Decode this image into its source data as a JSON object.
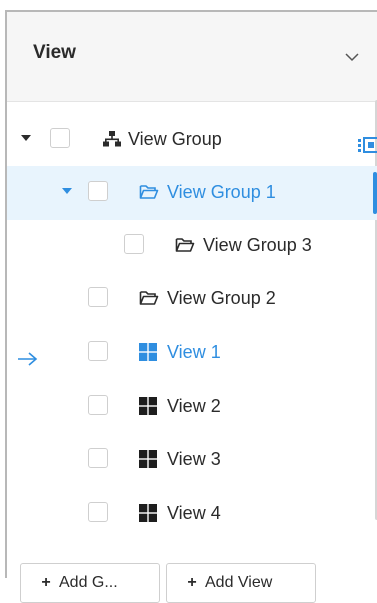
{
  "header": {
    "title": "View",
    "chevron_icon": "chevron-down-icon"
  },
  "tree": {
    "items": [
      {
        "label": "View Group",
        "icon": "org-tree-icon",
        "expanded": true,
        "level": 0,
        "selected": false,
        "active": false
      },
      {
        "label": "View Group 1",
        "icon": "folder-open-icon",
        "expanded": true,
        "level": 1,
        "selected": true,
        "active": false
      },
      {
        "label": "View Group 3",
        "icon": "folder-open-icon",
        "expanded": false,
        "level": 2,
        "selected": false,
        "active": false
      },
      {
        "label": "View Group 2",
        "icon": "folder-open-icon",
        "expanded": false,
        "level": 1,
        "selected": false,
        "active": false
      },
      {
        "label": "View 1",
        "icon": "grid-view-icon",
        "expanded": false,
        "level": 1,
        "selected": false,
        "active": true
      },
      {
        "label": "View 2",
        "icon": "grid-view-icon",
        "expanded": false,
        "level": 1,
        "selected": false,
        "active": false
      },
      {
        "label": "View 3",
        "icon": "grid-view-icon",
        "expanded": false,
        "level": 1,
        "selected": false,
        "active": false
      },
      {
        "label": "View 4",
        "icon": "grid-view-icon",
        "expanded": false,
        "level": 1,
        "selected": false,
        "active": false
      }
    ]
  },
  "footer": {
    "add_group_label": "Add G...",
    "add_view_label": "Add View"
  },
  "colors": {
    "accent": "#2f8ee0",
    "selected_bg": "#e8f4fd",
    "header_bg": "#f6f6f6",
    "text": "#2b2b2b"
  }
}
